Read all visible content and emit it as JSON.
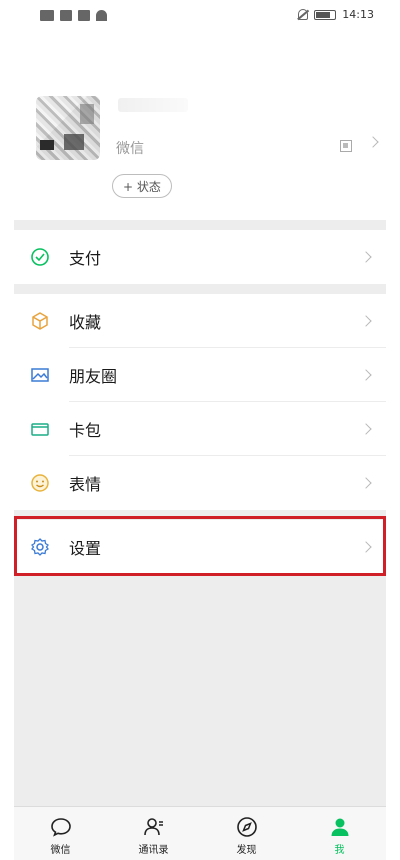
{
  "status_bar": {
    "time": "14:13"
  },
  "profile": {
    "wechat_id_label": "微信",
    "wechat_id_value": "",
    "status_button_label": "+ 状态"
  },
  "menu": {
    "pay": {
      "label": "支付",
      "icon": "wallet-check-icon"
    },
    "favorites": {
      "label": "收藏",
      "icon": "cube-icon"
    },
    "moments": {
      "label": "朋友圈",
      "icon": "picture-icon"
    },
    "cards": {
      "label": "卡包",
      "icon": "card-icon"
    },
    "stickers": {
      "label": "表情",
      "icon": "smiley-icon"
    },
    "settings": {
      "label": "设置",
      "icon": "gear-icon"
    }
  },
  "tabbar": {
    "tabs": [
      {
        "label": "微信",
        "icon": "chat-bubble-icon",
        "active": false
      },
      {
        "label": "通讯录",
        "icon": "contacts-icon",
        "active": false
      },
      {
        "label": "发现",
        "icon": "compass-icon",
        "active": false
      },
      {
        "label": "我",
        "icon": "person-icon",
        "active": true
      }
    ]
  },
  "colors": {
    "accent": "#07c160",
    "highlight": "#d01f26",
    "page_bg": "#ededed"
  }
}
